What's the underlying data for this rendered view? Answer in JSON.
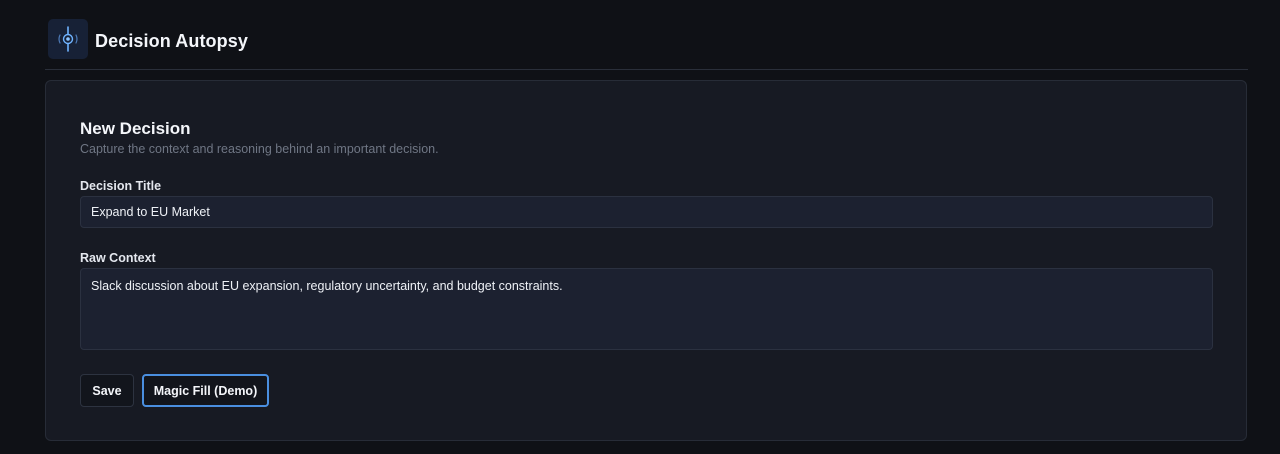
{
  "header": {
    "logo_icon": "crosshair-target-icon",
    "title": "Decision Autopsy"
  },
  "form": {
    "title": "New Decision",
    "subtitle": "Capture the context and reasoning behind an important decision.",
    "decision_title": {
      "label": "Decision Title",
      "value": "Expand to EU Market"
    },
    "raw_context": {
      "label": "Raw Context",
      "value": "Slack discussion about EU expansion, regulatory uncertainty, and budget constraints."
    },
    "buttons": {
      "save_label": "Save",
      "magic_fill_label": "Magic Fill (Demo)"
    }
  },
  "colors": {
    "background": "#0f1116",
    "card": "#171a23",
    "input": "#1c2130",
    "accent": "#4a8fe0"
  }
}
